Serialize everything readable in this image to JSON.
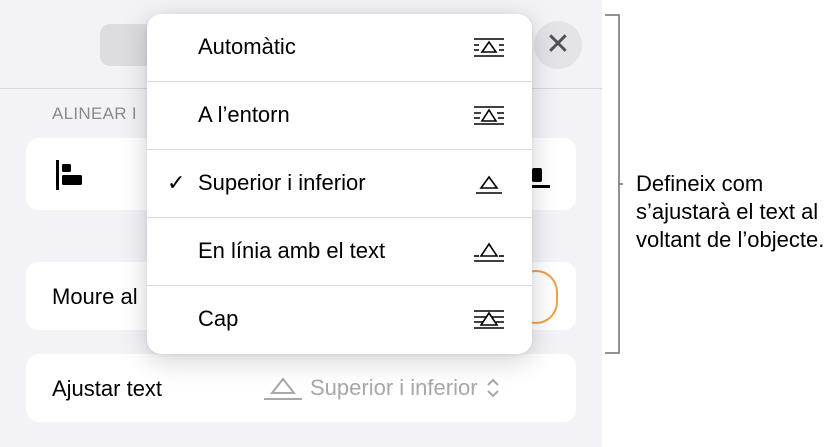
{
  "panel": {
    "section_label": "ALINEAR I",
    "close_symbol": "✕",
    "move_label": "Moure al",
    "wrap": {
      "label": "Ajustar text",
      "value": "Superior i inferior",
      "chevron": "⌃⌄"
    }
  },
  "menu": {
    "items": [
      {
        "label": "Automàtic",
        "checked": false,
        "icon": "wrap-automatic-icon"
      },
      {
        "label": "A l’entorn",
        "checked": false,
        "icon": "wrap-around-icon"
      },
      {
        "label": "Superior i inferior",
        "checked": true,
        "icon": "wrap-above-below-icon"
      },
      {
        "label": "En línia amb el text",
        "checked": false,
        "icon": "wrap-inline-icon"
      },
      {
        "label": "Cap",
        "checked": false,
        "icon": "wrap-none-icon"
      }
    ],
    "check_symbol": "✓"
  },
  "callout": {
    "text": "Defineix com s’ajustarà el text al voltant de l’objecte."
  },
  "colors": {
    "panel_bg": "#f2f2f7",
    "accent_orange": "#f0a04b",
    "secondary_text": "#8a8a8e"
  }
}
